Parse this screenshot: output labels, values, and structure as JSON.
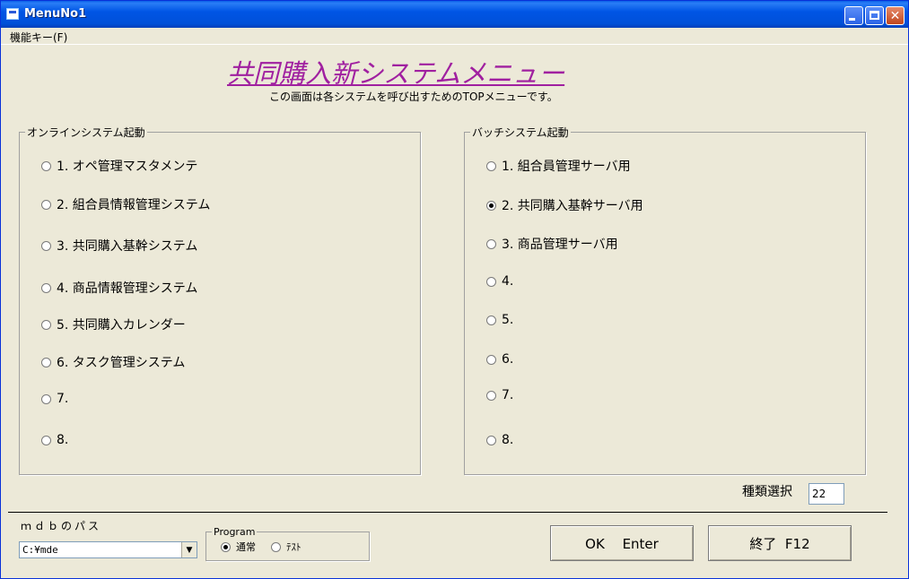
{
  "window": {
    "title": "MenuNo1"
  },
  "menubar": {
    "items": [
      "機能キー(F)"
    ]
  },
  "header": {
    "title": "共同購入新システムメニュー",
    "subtitle": "この画面は各システムを呼び出すためのTOPメニューです。"
  },
  "online": {
    "label": "オンラインシステム起動",
    "options": [
      {
        "label": "1. オペ管理マスタメンテ",
        "selected": false
      },
      {
        "label": "2. 組合員情報管理システム",
        "selected": false
      },
      {
        "label": "3. 共同購入基幹システム",
        "selected": false
      },
      {
        "label": "4. 商品情報管理システム",
        "selected": false
      },
      {
        "label": "5. 共同購入カレンダー",
        "selected": false
      },
      {
        "label": "6. タスク管理システム",
        "selected": false
      },
      {
        "label": "7.",
        "selected": false
      },
      {
        "label": "8.",
        "selected": false
      }
    ]
  },
  "batch": {
    "label": "バッチシステム起動",
    "options": [
      {
        "label": "1. 組合員管理サーバ用",
        "selected": false
      },
      {
        "label": "2. 共同購入基幹サーバ用",
        "selected": true
      },
      {
        "label": "3. 商品管理サーバ用",
        "selected": false
      },
      {
        "label": "4.",
        "selected": false
      },
      {
        "label": "5.",
        "selected": false
      },
      {
        "label": "6.",
        "selected": false
      },
      {
        "label": "7.",
        "selected": false
      },
      {
        "label": "8.",
        "selected": false
      }
    ]
  },
  "kind": {
    "label": "種類選択",
    "value": "22"
  },
  "mdb": {
    "label": "ｍｄｂのパス",
    "value": "C:¥mde"
  },
  "program": {
    "label": "Program",
    "options": [
      {
        "label": "通常",
        "selected": true
      },
      {
        "label": "ﾃｽﾄ",
        "selected": false
      }
    ]
  },
  "buttons": {
    "ok": "OK　 Enter",
    "exit": "終了  F12"
  }
}
